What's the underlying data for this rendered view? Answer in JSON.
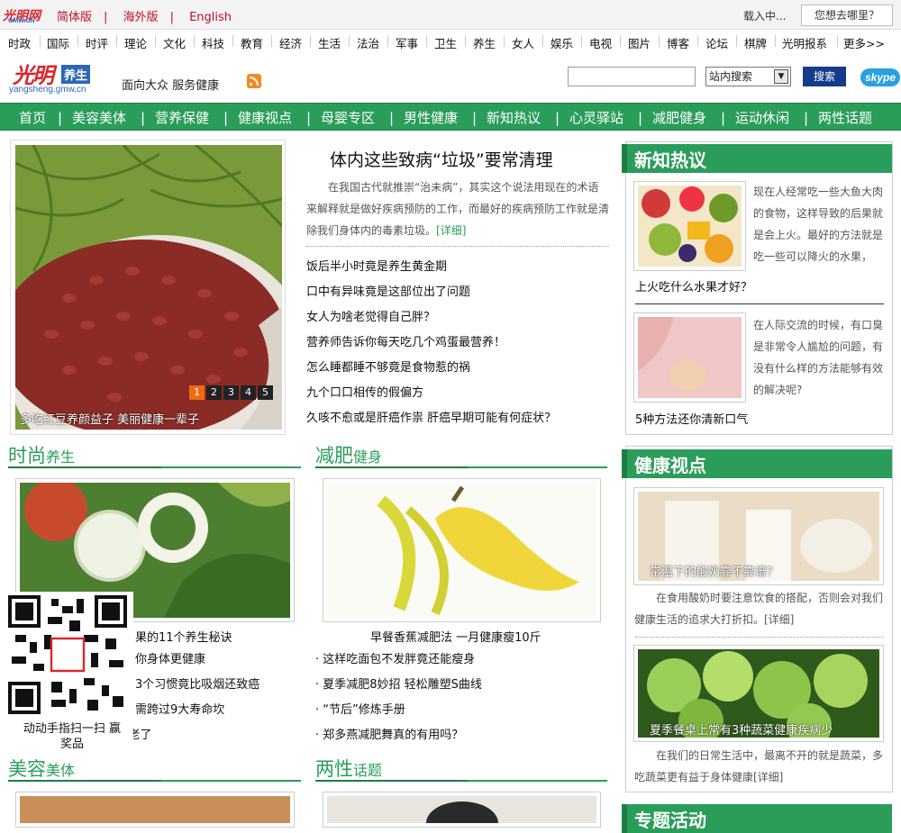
{
  "topbar": {
    "logo_text": "光明网",
    "logo_sub": "GMW.CN",
    "links": [
      "简体版",
      "海外版",
      "English"
    ],
    "loading": "载入中...",
    "where_button": "您想去哪里？"
  },
  "channels": [
    "时政",
    "国际",
    "时评",
    "理论",
    "文化",
    "科技",
    "教育",
    "经济",
    "生活",
    "法治",
    "军事",
    "卫生",
    "养生",
    "女人",
    "娱乐",
    "电视",
    "图片",
    "博客",
    "论坛",
    "棋牌",
    "光明报系",
    "更多>>"
  ],
  "brand": {
    "logo_cn": "光明",
    "logo_tag": "养生",
    "logo_url": "yangsheng.gmw.cn",
    "slogan": "面向大众 服务健康"
  },
  "search": {
    "placeholder": "",
    "scope": "站内搜索",
    "button": "搜索",
    "skype": "skype"
  },
  "mainnav": [
    "首页",
    "美容美体",
    "营养保健",
    "健康视点",
    "母婴专区",
    "男性健康",
    "新知热议",
    "心灵驿站",
    "减肥健身",
    "运动休闲",
    "两性话题"
  ],
  "focus": {
    "caption": "多吃红豆养颜益子 美丽健康一辈子",
    "pages": [
      "1",
      "2",
      "3",
      "4",
      "5"
    ],
    "active_page": "1"
  },
  "headline": {
    "title": "体内这些致病“垃圾”要常清理",
    "summary": "在我国古代就推崇“治未病”，其实这个说法用现在的术语来解释就是做好疾病预防的工作，而最好的疾病预防工作就是清除我们身体内的毒素垃圾。",
    "more": "[详细]"
  },
  "news": [
    "饭后半小时竟是养生黄金期",
    "口中有异味竟是这部位出了问题",
    "女人为啥老觉得自己胖？",
    "营养师告诉你每天吃几个鸡蛋最营养！",
    "怎么睡都睡不够竟是食物惹的祸",
    "九个口口相传的假偏方",
    "久咳不愈或是肝癌作祟 肝癌早期可能有何症状？"
  ],
  "fashion": {
    "title_a": "时尚",
    "title_b": "养生",
    "caption": "果的11个养生秘诀",
    "items": [
      "你身体更健康",
      "3个习惯竟比吸烟还致癌",
      "需跨过9大寿命坎",
      "· 这5大标志提醒男人变老了"
    ]
  },
  "slim": {
    "title_a": "减肥",
    "title_b": "健身",
    "caption": "早餐香蕉减肥法 一月健康瘦10斤",
    "items": [
      "· 这样吃面包不发胖竟还能瘦身",
      "· 夏季减肥8妙招 轻松雕塑S曲线",
      "· “节后”修炼手册",
      "· 郑多燕减肥舞真的有用吗？"
    ]
  },
  "qr": {
    "label": "动动手指扫一扫 赢奖品"
  },
  "beauty": {
    "title_a": "美容",
    "title_b": "美体"
  },
  "sex": {
    "title_a": "两性",
    "title_b": "话题"
  },
  "xinzhi": {
    "title": "新知热议",
    "item1_text": "现在人经常吃一些大鱼大肉的食物，这样导致的后果就是会上火。最好的方法就是吃一些可以降火的水果，",
    "item1_link": "上火吃什么水果才好？",
    "item2_text": "在人际交流的时候，有口臭是非常令人尴尬的问题，有没有什么样的方法能够有效的解决呢?",
    "item2_link": "5种方法还你清新口气"
  },
  "jiankang": {
    "title": "健康视点",
    "item1_caption": "常温下的酸奶靠不靠谱？",
    "item1_text": "在食用酸奶时要注意饮食的搭配，否则会对我们健康生活的追求大打折扣。[详细]",
    "item2_caption": "夏季餐桌上常有3种蔬菜健康疾病少",
    "item2_text": "在我们的日常生活中，最离不开的就是蔬菜，多吃蔬菜更有益于身体健康[详细]"
  },
  "special": {
    "title": "专题活动"
  }
}
